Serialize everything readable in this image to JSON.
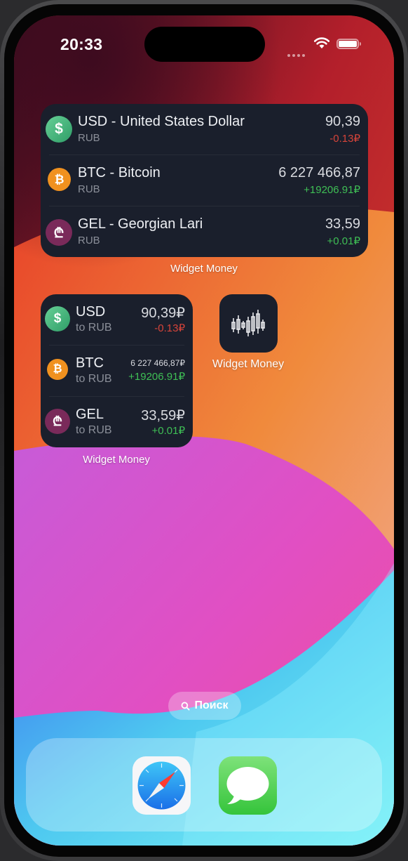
{
  "status_bar": {
    "time": "20:33"
  },
  "widget_large": {
    "label": "Widget Money",
    "rows": [
      {
        "icon": "dollar-icon",
        "title": "USD - United States Dollar",
        "subtitle": "RUB",
        "value": "90,39",
        "change": "-0.13₽",
        "trend": "down"
      },
      {
        "icon": "bitcoin-icon",
        "title": "BTC - Bitcoin",
        "subtitle": "RUB",
        "value": "6 227 466,87",
        "change": "+19206.91₽",
        "trend": "up"
      },
      {
        "icon": "lari-icon",
        "title": "GEL - Georgian Lari",
        "subtitle": "RUB",
        "value": "33,59",
        "change": "+0.01₽",
        "trend": "up"
      }
    ]
  },
  "widget_small": {
    "label": "Widget Money",
    "rows": [
      {
        "icon": "dollar-icon",
        "title": "USD",
        "subtitle": "to RUB",
        "value": "90,39₽",
        "change": "-0.13₽",
        "trend": "down"
      },
      {
        "icon": "bitcoin-icon",
        "title": "BTC",
        "subtitle": "to RUB",
        "value": "6 227 466,87₽",
        "change": "+19206.91₽",
        "trend": "up"
      },
      {
        "icon": "lari-icon",
        "title": "GEL",
        "subtitle": "to RUB",
        "value": "33,59₽",
        "change": "+0.01₽",
        "trend": "up"
      }
    ]
  },
  "app_icon": {
    "label": "Widget Money",
    "icon": "candlestick-chart-icon"
  },
  "search": {
    "label": "Поиск",
    "icon": "search-icon"
  },
  "dock": {
    "apps": [
      {
        "name": "safari-icon"
      },
      {
        "name": "messages-icon"
      }
    ]
  },
  "colors": {
    "negative": "#d6443a",
    "positive": "#3fbf55",
    "widget_bg": "#1a1f2c"
  }
}
